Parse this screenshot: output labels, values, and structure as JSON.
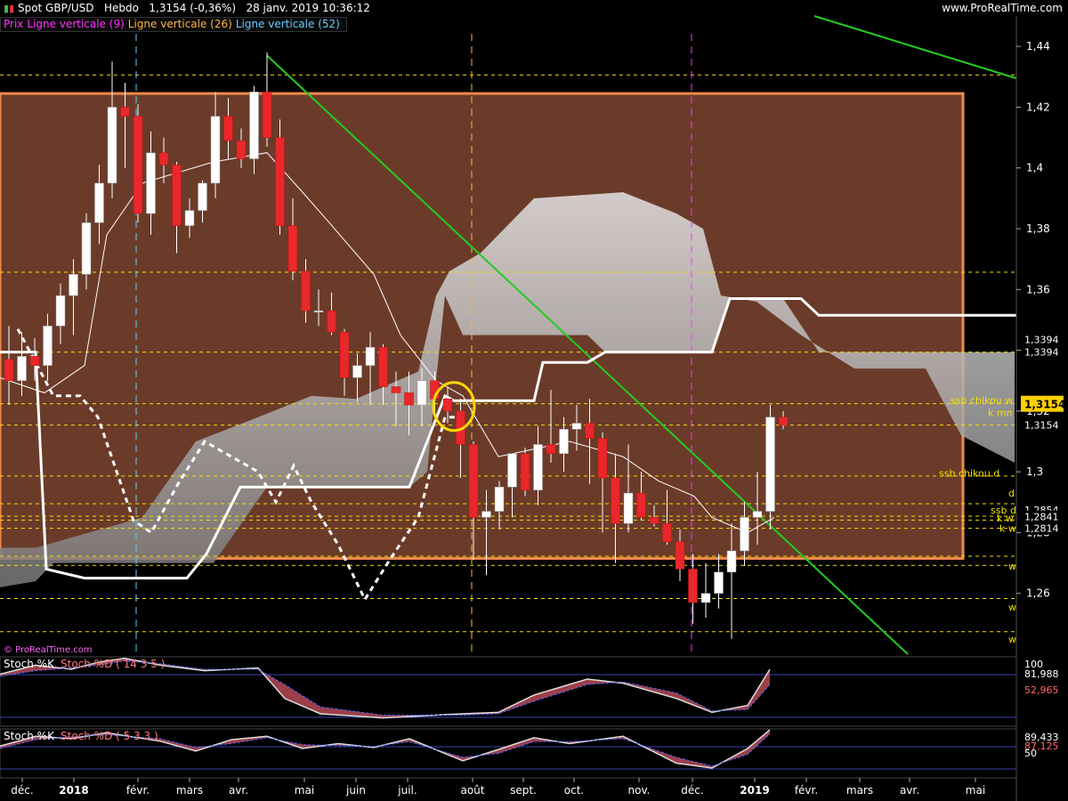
{
  "header": {
    "instrument": "Spot GBP/USD",
    "timeframe": "Hebdo",
    "last_quote": "1,3154 (-0,36%)",
    "datetime": "28 janv. 2019 10:36:12",
    "site": "www.ProRealTime.com"
  },
  "legend": [
    {
      "label": "Prix",
      "color": "#ff33ff"
    },
    {
      "label": "Ligne verticale (9)",
      "color": "#ff33ff"
    },
    {
      "label": "Ligne verticale (26)",
      "color": "#ffb347"
    },
    {
      "label": "Ligne verticale (52)",
      "color": "#66ccff"
    }
  ],
  "watermark": "© ProRealTime.com",
  "colors": {
    "bull": "#ffffff",
    "bear": "#e8282b",
    "zone_fill": "#6b3b2a",
    "zone_border": "#f08a4b",
    "cloud": "#cfcfcf",
    "trendline": "#22cc22",
    "highlight": "#ffd700",
    "level": "#f5e000",
    "price_tag": "#ffd000"
  },
  "chart_data": [
    {
      "type": "candlestick",
      "title": "Spot GBP/USD Hebdo",
      "ylim": [
        1.24,
        1.45
      ],
      "y_ticks": [
        "1,44",
        "1,42",
        "1,4",
        "1,38",
        "1,36",
        "1,34",
        "1,32",
        "1,3",
        "1,28",
        "1,26"
      ],
      "x_ticks": [
        "déc.",
        "2018",
        "févr.",
        "mars",
        "avr.",
        "mai",
        "juin",
        "juil.",
        "août",
        "sept.",
        "oct.",
        "nov.",
        "déc.",
        "2019",
        "févr.",
        "mars",
        "avr.",
        "mai"
      ],
      "candles": [
        {
          "o": 1.337,
          "h": 1.348,
          "l": 1.322,
          "c": 1.33
        },
        {
          "o": 1.33,
          "h": 1.346,
          "l": 1.325,
          "c": 1.338
        },
        {
          "o": 1.338,
          "h": 1.344,
          "l": 1.33,
          "c": 1.335
        },
        {
          "o": 1.335,
          "h": 1.352,
          "l": 1.33,
          "c": 1.348
        },
        {
          "o": 1.348,
          "h": 1.362,
          "l": 1.342,
          "c": 1.358
        },
        {
          "o": 1.358,
          "h": 1.37,
          "l": 1.345,
          "c": 1.365
        },
        {
          "o": 1.365,
          "h": 1.385,
          "l": 1.36,
          "c": 1.382
        },
        {
          "o": 1.382,
          "h": 1.401,
          "l": 1.375,
          "c": 1.395
        },
        {
          "o": 1.395,
          "h": 1.435,
          "l": 1.39,
          "c": 1.42
        },
        {
          "o": 1.42,
          "h": 1.428,
          "l": 1.4,
          "c": 1.417
        },
        {
          "o": 1.417,
          "h": 1.421,
          "l": 1.382,
          "c": 1.385
        },
        {
          "o": 1.385,
          "h": 1.412,
          "l": 1.378,
          "c": 1.405
        },
        {
          "o": 1.405,
          "h": 1.41,
          "l": 1.395,
          "c": 1.401
        },
        {
          "o": 1.401,
          "h": 1.402,
          "l": 1.372,
          "c": 1.381
        },
        {
          "o": 1.381,
          "h": 1.39,
          "l": 1.377,
          "c": 1.386
        },
        {
          "o": 1.386,
          "h": 1.396,
          "l": 1.382,
          "c": 1.395
        },
        {
          "o": 1.395,
          "h": 1.425,
          "l": 1.39,
          "c": 1.417
        },
        {
          "o": 1.417,
          "h": 1.423,
          "l": 1.403,
          "c": 1.409
        },
        {
          "o": 1.409,
          "h": 1.413,
          "l": 1.4,
          "c": 1.403
        },
        {
          "o": 1.403,
          "h": 1.427,
          "l": 1.398,
          "c": 1.425
        },
        {
          "o": 1.425,
          "h": 1.438,
          "l": 1.407,
          "c": 1.41
        },
        {
          "o": 1.41,
          "h": 1.416,
          "l": 1.378,
          "c": 1.381
        },
        {
          "o": 1.381,
          "h": 1.39,
          "l": 1.363,
          "c": 1.366
        },
        {
          "o": 1.366,
          "h": 1.37,
          "l": 1.349,
          "c": 1.353
        },
        {
          "o": 1.353,
          "h": 1.36,
          "l": 1.348,
          "c": 1.353
        },
        {
          "o": 1.353,
          "h": 1.359,
          "l": 1.345,
          "c": 1.346
        },
        {
          "o": 1.346,
          "h": 1.347,
          "l": 1.325,
          "c": 1.331
        },
        {
          "o": 1.331,
          "h": 1.339,
          "l": 1.323,
          "c": 1.335
        },
        {
          "o": 1.335,
          "h": 1.346,
          "l": 1.322,
          "c": 1.341
        },
        {
          "o": 1.341,
          "h": 1.342,
          "l": 1.322,
          "c": 1.328
        },
        {
          "o": 1.328,
          "h": 1.333,
          "l": 1.315,
          "c": 1.326
        },
        {
          "o": 1.326,
          "h": 1.333,
          "l": 1.312,
          "c": 1.322
        },
        {
          "o": 1.322,
          "h": 1.334,
          "l": 1.315,
          "c": 1.33
        },
        {
          "o": 1.33,
          "h": 1.333,
          "l": 1.318,
          "c": 1.324
        },
        {
          "o": 1.324,
          "h": 1.328,
          "l": 1.316,
          "c": 1.32
        },
        {
          "o": 1.32,
          "h": 1.324,
          "l": 1.298,
          "c": 1.309
        },
        {
          "o": 1.309,
          "h": 1.31,
          "l": 1.271,
          "c": 1.285
        },
        {
          "o": 1.285,
          "h": 1.294,
          "l": 1.266,
          "c": 1.287
        },
        {
          "o": 1.287,
          "h": 1.297,
          "l": 1.281,
          "c": 1.295
        },
        {
          "o": 1.295,
          "h": 1.306,
          "l": 1.285,
          "c": 1.306
        },
        {
          "o": 1.306,
          "h": 1.308,
          "l": 1.292,
          "c": 1.294
        },
        {
          "o": 1.294,
          "h": 1.315,
          "l": 1.289,
          "c": 1.309
        },
        {
          "o": 1.309,
          "h": 1.327,
          "l": 1.303,
          "c": 1.306
        },
        {
          "o": 1.306,
          "h": 1.318,
          "l": 1.3,
          "c": 1.314
        },
        {
          "o": 1.314,
          "h": 1.322,
          "l": 1.307,
          "c": 1.316
        },
        {
          "o": 1.316,
          "h": 1.324,
          "l": 1.296,
          "c": 1.311
        },
        {
          "o": 1.311,
          "h": 1.313,
          "l": 1.28,
          "c": 1.298
        },
        {
          "o": 1.298,
          "h": 1.306,
          "l": 1.27,
          "c": 1.283
        },
        {
          "o": 1.283,
          "h": 1.309,
          "l": 1.28,
          "c": 1.293
        },
        {
          "o": 1.293,
          "h": 1.3,
          "l": 1.284,
          "c": 1.285
        },
        {
          "o": 1.285,
          "h": 1.289,
          "l": 1.282,
          "c": 1.283
        },
        {
          "o": 1.283,
          "h": 1.294,
          "l": 1.276,
          "c": 1.277
        },
        {
          "o": 1.277,
          "h": 1.281,
          "l": 1.264,
          "c": 1.268
        },
        {
          "o": 1.268,
          "h": 1.273,
          "l": 1.25,
          "c": 1.257
        },
        {
          "o": 1.257,
          "h": 1.27,
          "l": 1.252,
          "c": 1.26
        },
        {
          "o": 1.26,
          "h": 1.273,
          "l": 1.255,
          "c": 1.267
        },
        {
          "o": 1.267,
          "h": 1.283,
          "l": 1.245,
          "c": 1.274
        },
        {
          "o": 1.274,
          "h": 1.29,
          "l": 1.269,
          "c": 1.285
        },
        {
          "o": 1.285,
          "h": 1.3,
          "l": 1.276,
          "c": 1.287
        },
        {
          "o": 1.287,
          "h": 1.322,
          "l": 1.281,
          "c": 1.318
        },
        {
          "o": 1.318,
          "h": 1.32,
          "l": 1.314,
          "c": 1.3154
        }
      ],
      "price_scale_labels": [
        "1,3394",
        "1,3394",
        "1,3154",
        "1,2814",
        "1,2854",
        "1,2841"
      ],
      "current_price": "1,3154",
      "right_level_labels": [
        "ssb chikou w",
        "k mn",
        "ssb chikou d",
        "d",
        "ssb d",
        "k w",
        "k w",
        "w",
        "w",
        "w"
      ]
    },
    {
      "type": "line",
      "title": "Stoch %K",
      "series_label": "Stoch %D ( 14 3 5 )",
      "y_ticks": [
        "100",
        "81,988",
        "52,965"
      ],
      "k_value": "81,988",
      "d_value": "52,965"
    },
    {
      "type": "line",
      "title": "Stoch %K",
      "series_label": "Stoch %D ( 5 3 3 )",
      "y_ticks": [
        "89,433",
        "87,125",
        "50"
      ],
      "k_value": "89,433",
      "d_value": "87,125"
    }
  ]
}
